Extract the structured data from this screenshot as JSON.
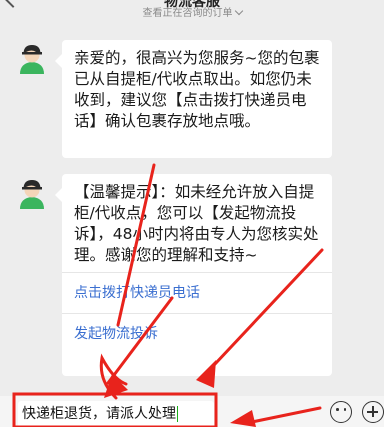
{
  "header": {
    "title": "物流客服",
    "subtitle": "查看正在咨询的订单"
  },
  "messages": [
    {
      "text": "亲爱的，很高兴为您服务~您的包裹已从自提柜/代收点取出。如您仍未收到，建议您【点击拨打快递员电话】确认包裹存放地点哦。"
    },
    {
      "text": "【温馨提示】：如未经允许放入自提柜/代收点，您可以【发起物流投诉】，48小时内将由专人为您核实处理。感谢您的理解和支持~",
      "links": [
        "点击拨打快递员电话",
        "发起物流投诉"
      ]
    }
  ],
  "input": {
    "value": "快递柜退货，请派人处理"
  },
  "icons": [
    "back-arrow-icon",
    "chevron-down-icon",
    "avatar-icon",
    "emoji-icon",
    "plus-icon"
  ],
  "colors": {
    "background": "#ededed",
    "link": "#3b6fd0",
    "annotation": "#e8231c",
    "avatar_shirt": "#3bb55e"
  }
}
